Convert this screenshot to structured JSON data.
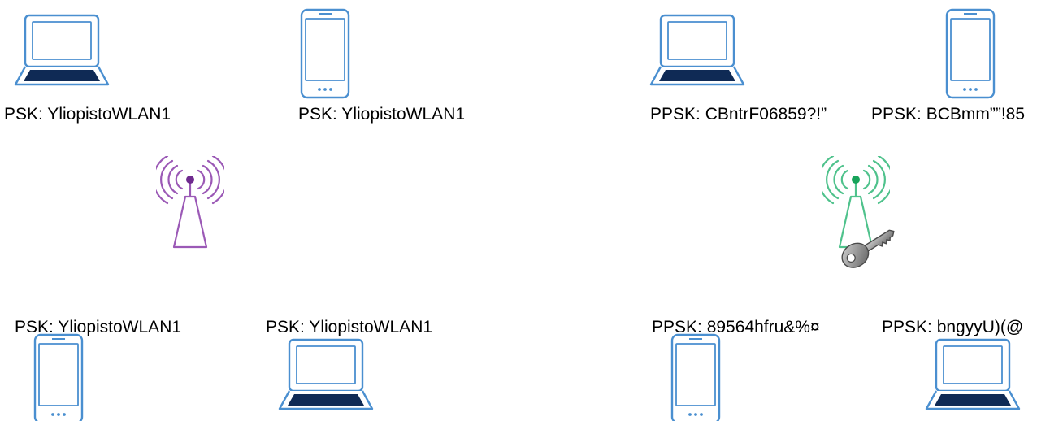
{
  "colors": {
    "device_outline": "#4a8fd0",
    "device_dark": "#0f2a55",
    "psk_tower": "#9b59b6",
    "psk_tower_center": "#6f2a8f",
    "ppsk_tower": "#4fc28c",
    "ppsk_tower_center": "#17a35a",
    "key_fill": "#8e8e8e",
    "key_dark": "#555555",
    "text": "#000000"
  },
  "psk_network": {
    "access_point_icon": "wireless-tower-icon",
    "clients": [
      {
        "device": "laptop-icon",
        "label": "PSK: YliopistoWLAN1"
      },
      {
        "device": "smartphone-icon",
        "label": "PSK: YliopistoWLAN1"
      },
      {
        "device": "smartphone-icon",
        "label": "PSK: YliopistoWLAN1"
      },
      {
        "device": "laptop-icon",
        "label": "PSK: YliopistoWLAN1"
      }
    ]
  },
  "ppsk_network": {
    "access_point_icon": "wireless-tower-icon",
    "key_icon": "key-icon",
    "clients": [
      {
        "device": "laptop-icon",
        "label": "PPSK: CBntrF06859?!”"
      },
      {
        "device": "smartphone-icon",
        "label": "PPSK: BCBmm””!85"
      },
      {
        "device": "smartphone-icon",
        "label": "PPSK: 89564hfru&%¤"
      },
      {
        "device": "laptop-icon",
        "label": "PPSK: bngyyU)(@"
      }
    ]
  }
}
